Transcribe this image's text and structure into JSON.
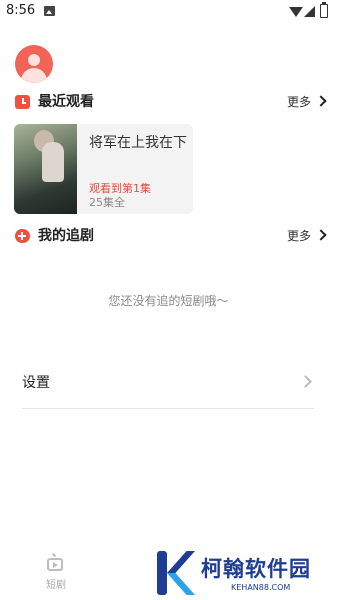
{
  "status_bar": {
    "time": "8:56"
  },
  "recent": {
    "title": "最近观看",
    "more": "更多",
    "items": [
      {
        "name": "将军在上我在下",
        "progress": "观看到第1集",
        "episodes": "25集全"
      }
    ]
  },
  "following": {
    "title": "我的追剧",
    "more": "更多",
    "empty": "您还没有追的短剧哦～"
  },
  "settings": {
    "label": "设置"
  },
  "tab_bar": {
    "items": [
      {
        "label": "短剧",
        "icon": "tv-icon"
      }
    ]
  },
  "watermark": {
    "title": "柯翰软件园",
    "sub": "KEHAN88.COM"
  },
  "colors": {
    "accent": "#f0513f",
    "progress": "#e84a3c",
    "watermark": "#1f3d92"
  }
}
